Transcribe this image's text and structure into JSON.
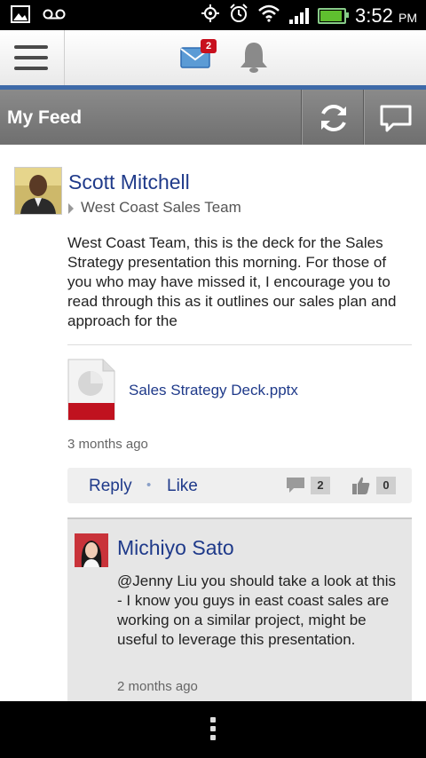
{
  "status_bar": {
    "time": "3:52",
    "ampm": "PM",
    "battery_level": 0.85
  },
  "top_bar": {
    "mail_badge": "2"
  },
  "feed_header": {
    "title": "My Feed"
  },
  "post": {
    "author": "Scott Mitchell",
    "group": "West Coast Sales Team",
    "body": "West Coast Team, this is the deck for the Sales Strategy presentation this morning. For those of you who may have missed it, I encourage you to read through this as it outlines our sales plan and approach for the",
    "attachment_name": "Sales Strategy Deck.pptx",
    "time": "3 months ago",
    "reply_label": "Reply",
    "separator": "•",
    "like_label": "Like",
    "comment_count": "2",
    "like_count": "0"
  },
  "comment": {
    "author": "Michiyo Sato",
    "body": "@Jenny Liu you should take a look at this - I know you guys in east coast sales are working on a similar project, might be useful to leverage this presentation.",
    "time": "2 months ago"
  },
  "colors": {
    "accent_blue": "#1f3a8a",
    "header_line": "#3e6aa8",
    "badge_red": "#c8101e"
  }
}
